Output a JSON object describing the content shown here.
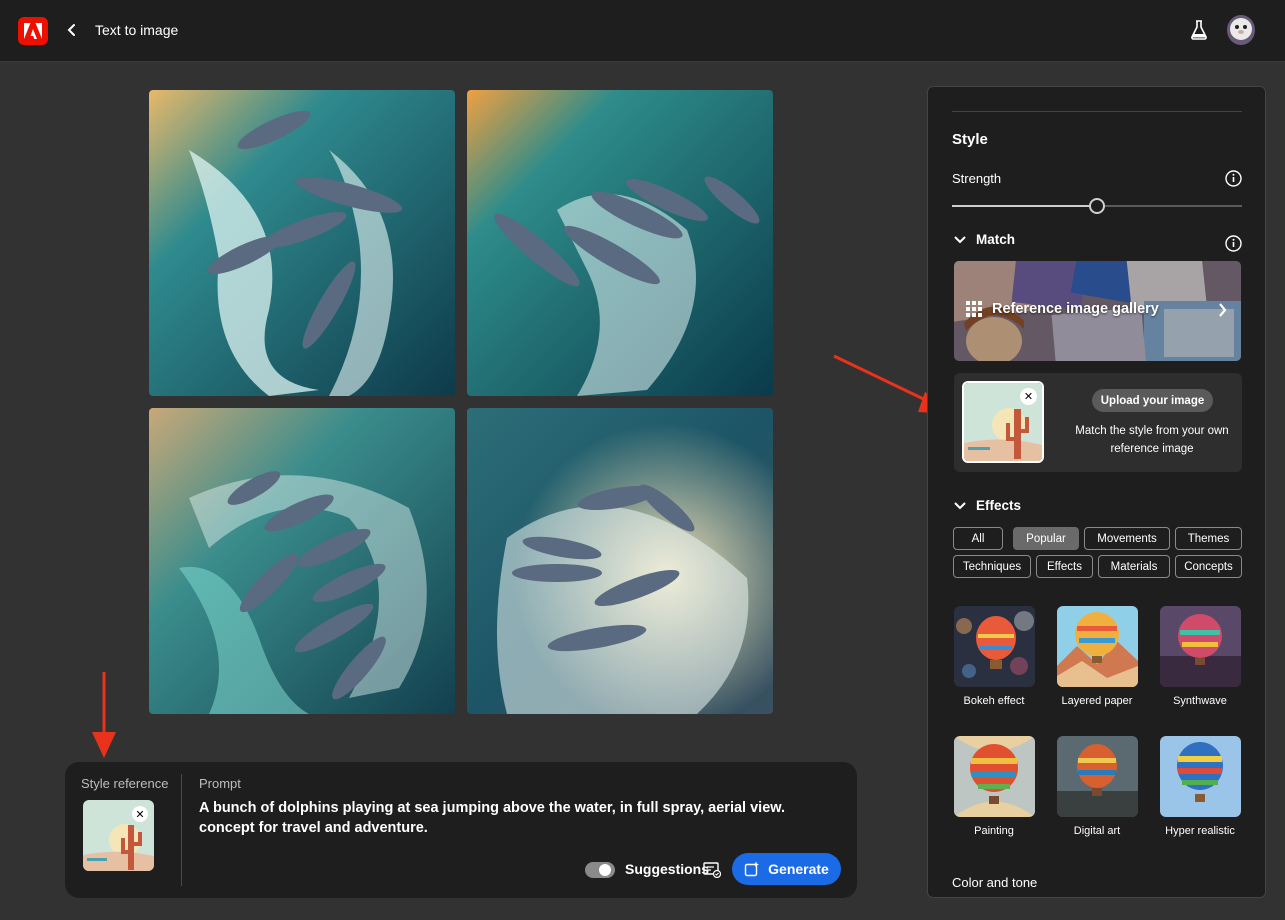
{
  "header": {
    "title": "Text to image"
  },
  "prompt_bar": {
    "style_reference_label": "Style reference",
    "prompt_label": "Prompt",
    "prompt_text": "A bunch of dolphins playing at sea jumping above the water, in full spray, aerial view. concept for travel and adventure.",
    "suggestions_label": "Suggestions",
    "generate_label": "Generate"
  },
  "panel": {
    "style_heading": "Style",
    "strength_label": "Strength",
    "strength_value": 0.5,
    "match_heading": "Match",
    "gallery_label": "Reference image gallery",
    "upload_button": "Upload your image",
    "upload_desc": "Match the style from your own reference image",
    "effects_heading": "Effects",
    "chips": [
      "All",
      "Popular",
      "Movements",
      "Themes",
      "Techniques",
      "Effects",
      "Materials",
      "Concepts"
    ],
    "active_chip": "Popular",
    "effects": [
      "Bokeh effect",
      "Layered paper",
      "Synthwave",
      "Painting",
      "Digital art",
      "Hyper realistic"
    ],
    "color_tone": "Color and tone"
  },
  "colors": {
    "accent": "#1b6ae6",
    "annotation_arrow": "#e8321c",
    "brand": "#eb1000"
  }
}
